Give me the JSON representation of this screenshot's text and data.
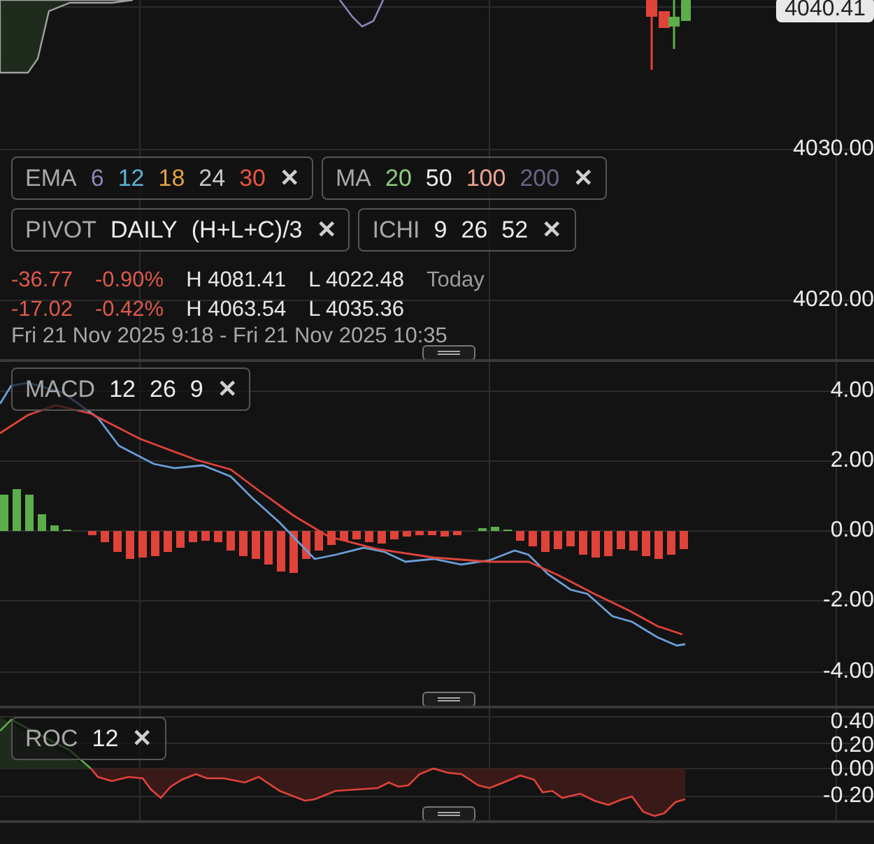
{
  "main": {
    "price_tag": "4040.41",
    "axis": [
      {
        "label": "4030.00"
      },
      {
        "label": "4020.00"
      }
    ],
    "legends": [
      [
        {
          "name": "EMA",
          "params": [
            {
              "text": "6",
              "color": "#8a86b8"
            },
            {
              "text": "12",
              "color": "#5ab4d4"
            },
            {
              "text": "18",
              "color": "#e6a246"
            },
            {
              "text": "24",
              "color": "#c8c8c8"
            },
            {
              "text": "30",
              "color": "#e8553e"
            }
          ],
          "close": "✕"
        },
        {
          "name": "MA",
          "params": [
            {
              "text": "20",
              "color": "#8fcf7e"
            },
            {
              "text": "50",
              "color": "#ececec"
            },
            {
              "text": "100",
              "color": "#f0a392"
            },
            {
              "text": "200",
              "color": "#6b6484"
            }
          ],
          "close": "✕"
        }
      ],
      [
        {
          "name": "PIVOT",
          "params": [
            {
              "text": "DAILY",
              "color": "#ececec"
            },
            {
              "text": "(H+L+C)/3",
              "color": "#ececec"
            }
          ],
          "close": "✕"
        },
        {
          "name": "ICHI",
          "params": [
            {
              "text": "9",
              "color": "#ececec"
            },
            {
              "text": "26",
              "color": "#ececec"
            },
            {
              "text": "52",
              "color": "#ececec"
            }
          ],
          "close": "✕"
        }
      ]
    ],
    "stats": [
      {
        "change": "-36.77",
        "percent": "-0.90%",
        "high": "H 4081.41",
        "low": "L 4022.48",
        "period": "Today"
      },
      {
        "change": "-17.02",
        "percent": "-0.42%",
        "high": "H 4063.54",
        "low": "L 4035.36"
      }
    ],
    "date_range": "Fri 21 Nov 2025 9:18 - Fri 21 Nov 2025 10:35"
  },
  "macd": {
    "legend": {
      "name": "MACD",
      "params": [
        {
          "text": "12",
          "color": "#ececec"
        },
        {
          "text": "26",
          "color": "#ececec"
        },
        {
          "text": "9",
          "color": "#ececec"
        }
      ],
      "close": "✕"
    },
    "axis": [
      {
        "label": "4.00"
      },
      {
        "label": "2.00"
      },
      {
        "label": "0.00"
      },
      {
        "label": "-2.00"
      },
      {
        "label": "-4.00"
      }
    ]
  },
  "roc": {
    "legend": {
      "name": "ROC",
      "params": [
        {
          "text": "12",
          "color": "#ececec"
        }
      ],
      "close": "✕"
    },
    "axis": [
      {
        "label": "0.40"
      },
      {
        "label": "0.20"
      },
      {
        "label": "0.00"
      },
      {
        "label": "-0.20"
      }
    ]
  }
}
